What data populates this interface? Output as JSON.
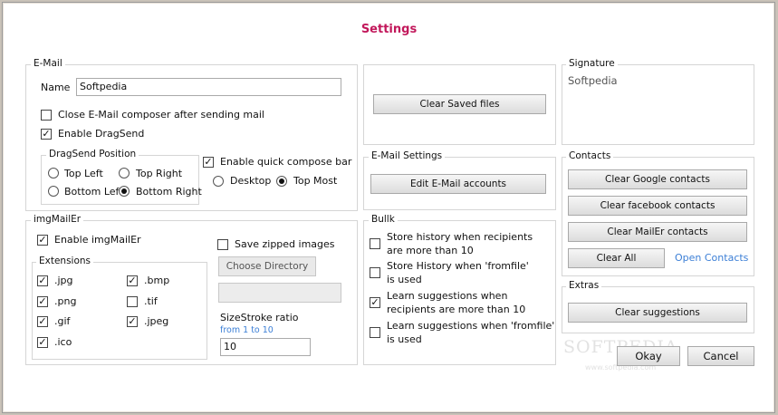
{
  "title": "Settings",
  "email": {
    "legend": "E-Mail",
    "name_label": "Name",
    "name_value": "Softpedia",
    "close_composer": {
      "label": "Close E-Mail composer after sending mail",
      "checked": false
    },
    "enable_dragsend": {
      "label": "Enable DragSend",
      "checked": true
    },
    "dragsend_position": {
      "legend": "DragSend Position",
      "options": [
        "Top Left",
        "Top Right",
        "Bottom Left",
        "Bottom Right"
      ],
      "selected": "Bottom Right"
    },
    "quick_compose": {
      "label": "Enable quick compose bar",
      "checked": true
    },
    "compose_position": {
      "options": [
        "Desktop",
        "Top Most"
      ],
      "selected": "Top Most"
    }
  },
  "saved_files": {
    "clear_label": "Clear Saved files"
  },
  "email_settings": {
    "legend": "E-Mail Settings",
    "edit_label": "Edit E-Mail accounts"
  },
  "signature": {
    "legend": "Signature",
    "value": "Softpedia"
  },
  "contacts": {
    "legend": "Contacts",
    "clear_google": "Clear Google contacts",
    "clear_facebook": "Clear facebook contacts",
    "clear_mailer": "Clear MailEr contacts",
    "clear_all": "Clear All",
    "open_contacts": "Open Contacts"
  },
  "imgmailer": {
    "legend": "imgMailEr",
    "enable": {
      "label": "Enable imgMailEr",
      "checked": true
    },
    "save_zipped": {
      "label": "Save zipped images",
      "checked": false
    },
    "choose_directory": "Choose Directory",
    "extensions_legend": "Extensions",
    "extensions": [
      {
        "label": ".jpg",
        "checked": true
      },
      {
        "label": ".bmp",
        "checked": true
      },
      {
        "label": ".png",
        "checked": true
      },
      {
        "label": ".tif",
        "checked": false
      },
      {
        "label": ".gif",
        "checked": true
      },
      {
        "label": ".jpeg",
        "checked": true
      },
      {
        "label": ".ico",
        "checked": true
      }
    ],
    "sizestroke_label": "SizeStroke ratio",
    "sizestroke_hint": "from 1 to 10",
    "sizestroke_value": "10"
  },
  "bulk": {
    "legend": "Bullk",
    "options": [
      {
        "label_line1": "Store history when recipients",
        "label_line2": "are more than 10",
        "checked": false
      },
      {
        "label_line1": "Store History when 'fromfile'",
        "label_line2": "is used",
        "checked": false
      },
      {
        "label_line1": "Learn suggestions when",
        "label_line2": "recipients are more than 10",
        "checked": true
      },
      {
        "label_line1": "Learn suggestions when 'fromfile'",
        "label_line2": "is used",
        "checked": false
      }
    ]
  },
  "extras": {
    "legend": "Extras",
    "clear_suggestions": "Clear suggestions"
  },
  "footer": {
    "ok_label": "Okay",
    "cancel_label": "Cancel"
  },
  "watermark": {
    "text": "SOFTPEDIA",
    "url": "www.softpedia.com"
  },
  "colors": {
    "title": "#c2185b",
    "link": "#3c7fd6",
    "hint": "#3c7fd6"
  }
}
